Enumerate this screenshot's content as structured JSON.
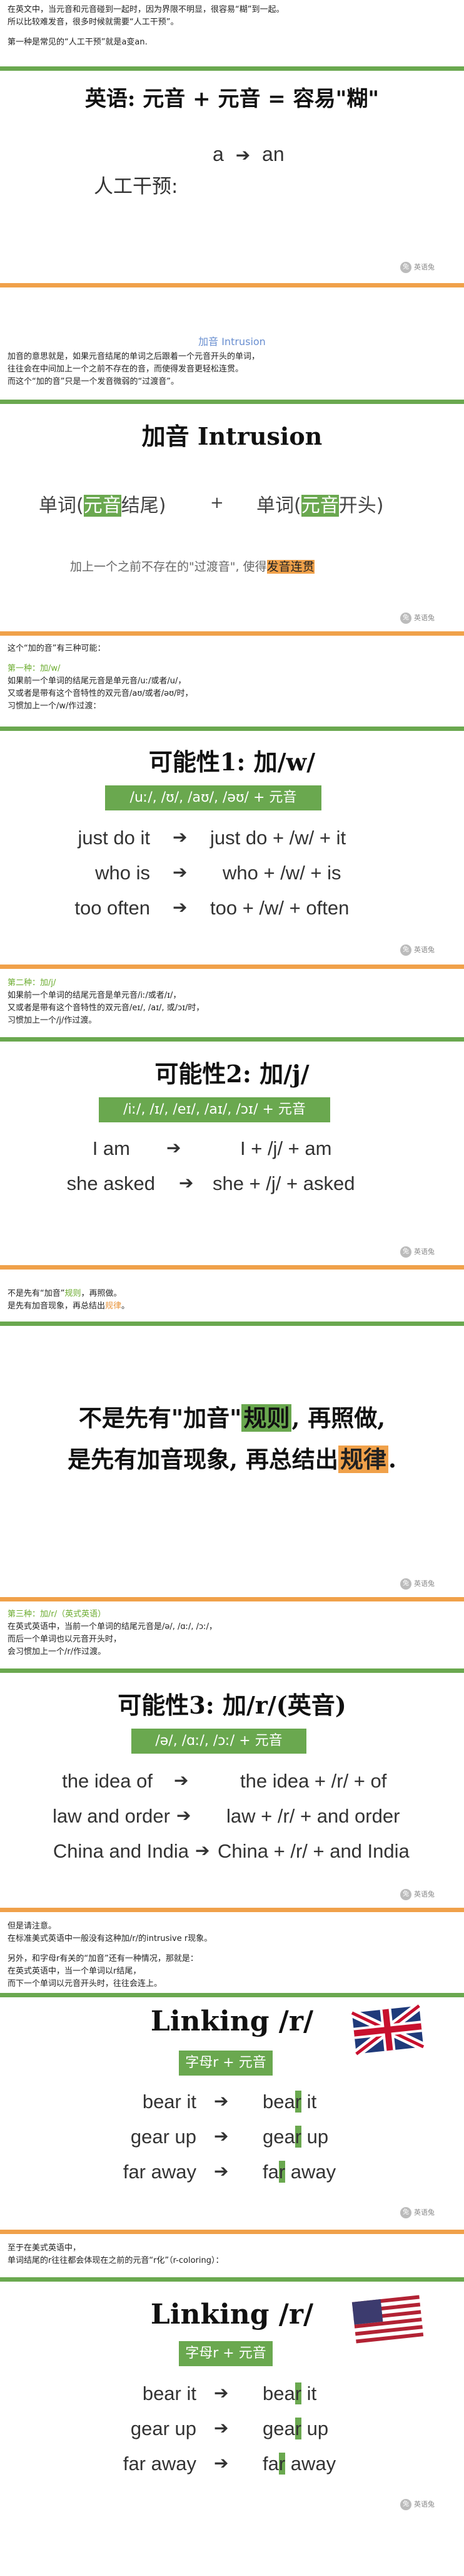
{
  "intro": {
    "line1": "在英文中，当元音和元音碰到一起时，因为界限不明显，很容易“糊”到一起。",
    "line2": "所以比较难发音，很多时候就需要“人工干预”。",
    "line3": "第一种是常见的“人工干预”就是a变an."
  },
  "slide1": {
    "title": "英语: 元音 + 元音 = 容易\"糊\"",
    "left_label": "人工干预:",
    "a": "a",
    "an": "an",
    "logo": "英语兔"
  },
  "section_intrusion": {
    "heading": "加音 Intrusion",
    "line1": "加音的意思就是，如果元音结尾的单词之后跟着一个元音开头的单词，",
    "line2": "往往会在中间加上一个之前不存在的音，而使得发音更轻松连贯。",
    "line3": "而这个“加的音”只是一个发音微弱的“过渡音”。"
  },
  "slide2": {
    "title": "加音 Intrusion",
    "word1_pre": "单词(",
    "word1_hl": "元音",
    "word1_post": "结尾)",
    "plus": "+",
    "word2_pre": "单词(",
    "word2_hl": "元音",
    "word2_post": "开头)",
    "note_pre": "加上一个之前不存在的\"过渡音\", 使得",
    "note_hl": "发音连贯",
    "logo": "英语兔"
  },
  "section_three": {
    "line1": "这个“加的音”有三种可能：",
    "kind1_head": "第一种：加/w/",
    "kind1_l1": "如果前一个单词的结尾元音是单元音/uː/或者/u/，",
    "kind1_l2": "又或者是带有这个音特性的双元音/aʊ/或者/əʊ/时，",
    "kind1_l3": "习惯加上一个/w/作过渡："
  },
  "slide3": {
    "title": "可能性1: 加/w/",
    "box": "/uː/, /ʊ/, /aʊ/, /əʊ/ + 元音",
    "rows": [
      {
        "left": "just do it",
        "right": "just do + /w/ + it"
      },
      {
        "left": "who is",
        "right": "who + /w/ + is"
      },
      {
        "left": "too often",
        "right": "too + /w/ + often"
      }
    ],
    "logo": "英语兔"
  },
  "section_kind2": {
    "head": "第二种：加/j/",
    "l1": "如果前一个单词的结尾元音是单元音/iː/或者/ɪ/，",
    "l2": "又或者是带有这个音特性的双元音/eɪ/, /aɪ/, 或/ɔɪ/时，",
    "l3": "习惯加上一个/j/作过渡。"
  },
  "slide4": {
    "title": "可能性2: 加/j/",
    "box": "/iː/, /ɪ/, /eɪ/, /aɪ/, /ɔɪ/ + 元音",
    "rows": [
      {
        "left": "I am",
        "right": "I + /j/ + am"
      },
      {
        "left": "she asked",
        "right": "she + /j/ + asked"
      }
    ],
    "logo": "英语兔"
  },
  "section_rule": {
    "l1_pre": "不是先有“加音”",
    "l1_hl": "规则",
    "l1_post": "，再照做。",
    "l2_pre": "是先有加音现象，再总结出",
    "l2_hl": "规律",
    "l2_post": "。"
  },
  "slide5": {
    "l1_pre": "不是先有\"加音\"",
    "l1_hl": "规则",
    "l1_post": ", 再照做,",
    "l2_pre": "是先有加音现象, 再总结出",
    "l2_hl": "规律",
    "l2_post": ".",
    "logo": "英语兔"
  },
  "section_kind3": {
    "head": "第三种：加/r/（英式英语）",
    "l1": "在英式英语中，当前一个单词的结尾元音是/ə/, /ɑː/, /ɔː/，",
    "l2": "而后一个单词也以元音开头时，",
    "l3": "会习惯加上一个/r/作过渡。"
  },
  "slide6": {
    "title": "可能性3: 加/r/(英音)",
    "box": "/ə/, /ɑː/, /ɔː/ + 元音",
    "rows": [
      {
        "left": "the idea of",
        "right": "the idea + /r/ + of"
      },
      {
        "left": "law and order",
        "right": "law + /r/ + and order"
      },
      {
        "left": "China and India",
        "right": "China + /r/ + and India"
      }
    ],
    "logo": "英语兔"
  },
  "section_note": {
    "l1": "但是请注意。",
    "l2": "在标准美式英语中一般没有这种加/r/的intrusive r现象。",
    "l3": "另外，和字母r有关的“加音”还有一种情况，那就是：",
    "l4": "在英式英语中，当一个单词以r结尾，",
    "l5": "而下一个单词以元音开头时，往往会连上。"
  },
  "slide7": {
    "title": "Linking /r/",
    "box": "字母r + 元音",
    "rows": [
      {
        "left": "bear it",
        "r1": "bea",
        "rhl": "r",
        "r2": " it"
      },
      {
        "left": "gear up",
        "r1": "gea",
        "rhl": "r",
        "r2": " up"
      },
      {
        "left": "far away",
        "r1": "fa",
        "rhl": "r",
        "r2": " away"
      }
    ],
    "logo": "英语兔"
  },
  "section_us": {
    "l1": "至于在美式英语中，",
    "l2": "单词结尾的r往往都会体现在之前的元音“r化”（r-coloring）："
  },
  "slide8": {
    "title": "Linking /r/",
    "box": "字母r + 元音",
    "rows": [
      {
        "left": "bear it",
        "r1": "bea",
        "rhl": "r",
        "r2": " it"
      },
      {
        "left": "gear up",
        "r1": "gea",
        "rhl": "r",
        "r2": " up"
      },
      {
        "left": "far away",
        "r1": "fa",
        "rhl": "r",
        "r2": " away"
      }
    ],
    "logo": "英语兔"
  },
  "colors": {
    "green": "#6aa84f",
    "orange": "#f0a14a",
    "text_green": "#6aab2d"
  }
}
